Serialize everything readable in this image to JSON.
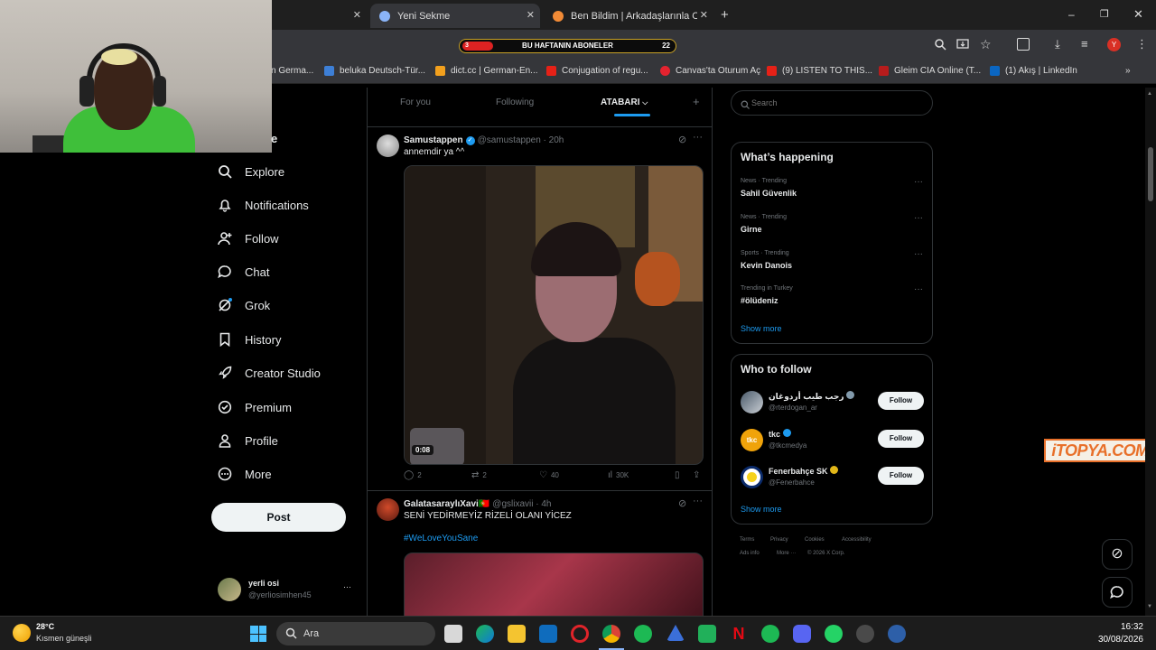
{
  "browser": {
    "tabs": [
      {
        "label": "Yeni Sekme"
      },
      {
        "label": "Ben Bildim | Arkadaşlarınla Onli"
      }
    ],
    "new_tab_label": "+",
    "window_controls": {
      "minimize": "–",
      "maximize": "❐",
      "close": "✕"
    }
  },
  "overlay_banner": {
    "left_value": "3",
    "title": "BU HAFTANIN ABONELER",
    "right_value": "22"
  },
  "bookmarks": [
    {
      "label": "n Germa..."
    },
    {
      "label": "beluka Deutsch-Tür..."
    },
    {
      "label": "dict.cc | German-En..."
    },
    {
      "label": "Conjugation of regu..."
    },
    {
      "label": "Canvas'ta Oturum Aç"
    },
    {
      "label": "(9) LISTEN TO THIS..."
    },
    {
      "label": "Gleim CIA Online (T..."
    },
    {
      "label": "(1) Akış | LinkedIn"
    }
  ],
  "sidebar": {
    "partial_label": "e",
    "items": [
      {
        "label": "Explore"
      },
      {
        "label": "Notifications"
      },
      {
        "label": "Follow"
      },
      {
        "label": "Chat"
      },
      {
        "label": "Grok"
      },
      {
        "label": "History"
      },
      {
        "label": "Creator Studio"
      },
      {
        "label": "Premium"
      },
      {
        "label": "Profile"
      },
      {
        "label": "More"
      }
    ],
    "post_label": "Post",
    "account": {
      "name": "yerli osi",
      "handle": "@yerliosimhen45",
      "more": "···"
    }
  },
  "timeline": {
    "tabs": [
      {
        "label": "For you"
      },
      {
        "label": "Following"
      },
      {
        "label": "ATABARI"
      }
    ],
    "add_tab": "+",
    "tweets": [
      {
        "name": "Samustappen",
        "handle": "@samustappen · 20h",
        "text": "annemdir ya ^^",
        "video_time": "0:08",
        "replies": "2",
        "reposts": "2",
        "likes": "40",
        "views": "30K"
      },
      {
        "name": "GalatasaraylıXavi🇵🇹",
        "handle": "@gslixavii · 4h",
        "text": "SENİ YEDİRMEYİZ RİZELİ  OLANI YİCEZ",
        "hashtag": "#WeLoveYouSane"
      }
    ]
  },
  "right": {
    "search_placeholder": "Search",
    "whats_happening": {
      "title": "What’s happening",
      "trends": [
        {
          "meta": "News · Trending",
          "name": "Sahil Güvenlik"
        },
        {
          "meta": "News · Trending",
          "name": "Girne"
        },
        {
          "meta": "Sports · Trending",
          "name": "Kevin Danois"
        },
        {
          "meta": "Trending in Turkey",
          "name": "#ölüdeniz"
        }
      ],
      "show_more": "Show more"
    },
    "who_to_follow": {
      "title": "Who to follow",
      "accounts": [
        {
          "name": "رجب طيب أردوغان",
          "handle": "@rterdogan_ar",
          "button": "Follow"
        },
        {
          "name": "tkc",
          "handle": "@tkcmedya",
          "button": "Follow",
          "avatar_text": "tkc"
        },
        {
          "name": "Fenerbahçe SK",
          "handle": "@Fenerbahce",
          "button": "Follow"
        }
      ],
      "show_more": "Show more"
    },
    "footer": {
      "links": [
        "Terms",
        "Privacy",
        "Cookies",
        "Accessibility",
        "Ads info",
        "More ···",
        "© 2026 X Corp."
      ]
    }
  },
  "watermark": "iTOPYA.COM",
  "taskbar": {
    "weather_temp": "28°C",
    "weather_desc": "Kısmen güneşli",
    "search_label": "Ara",
    "time": "16:32",
    "date": "30/08/2026"
  }
}
